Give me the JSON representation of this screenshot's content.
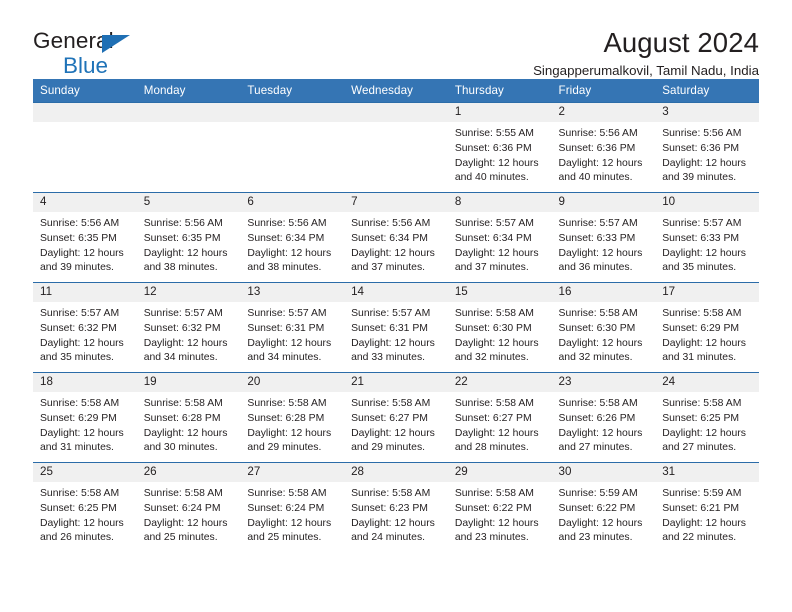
{
  "brand": {
    "line1": "General",
    "line2": "Blue",
    "triangle_color": "#1f6fb4",
    "text_color": "#231f20",
    "accent_color": "#1f73b8"
  },
  "header": {
    "title": "August 2024",
    "subtitle": "Singapperumalkovil, Tamil Nadu, India"
  },
  "calendar": {
    "header_bg": "#3575b4",
    "header_text": "#ffffff",
    "daynum_bg": "#f0f0f0",
    "row_border": "#2b6ca8",
    "weekday_headers": [
      "Sunday",
      "Monday",
      "Tuesday",
      "Wednesday",
      "Thursday",
      "Friday",
      "Saturday"
    ],
    "weeks": [
      [
        {
          "day": "",
          "sunrise": "",
          "sunset": "",
          "daylight_line1": "",
          "daylight_line2": ""
        },
        {
          "day": "",
          "sunrise": "",
          "sunset": "",
          "daylight_line1": "",
          "daylight_line2": ""
        },
        {
          "day": "",
          "sunrise": "",
          "sunset": "",
          "daylight_line1": "",
          "daylight_line2": ""
        },
        {
          "day": "",
          "sunrise": "",
          "sunset": "",
          "daylight_line1": "",
          "daylight_line2": ""
        },
        {
          "day": "1",
          "sunrise": "Sunrise: 5:55 AM",
          "sunset": "Sunset: 6:36 PM",
          "daylight_line1": "Daylight: 12 hours",
          "daylight_line2": "and 40 minutes."
        },
        {
          "day": "2",
          "sunrise": "Sunrise: 5:56 AM",
          "sunset": "Sunset: 6:36 PM",
          "daylight_line1": "Daylight: 12 hours",
          "daylight_line2": "and 40 minutes."
        },
        {
          "day": "3",
          "sunrise": "Sunrise: 5:56 AM",
          "sunset": "Sunset: 6:36 PM",
          "daylight_line1": "Daylight: 12 hours",
          "daylight_line2": "and 39 minutes."
        }
      ],
      [
        {
          "day": "4",
          "sunrise": "Sunrise: 5:56 AM",
          "sunset": "Sunset: 6:35 PM",
          "daylight_line1": "Daylight: 12 hours",
          "daylight_line2": "and 39 minutes."
        },
        {
          "day": "5",
          "sunrise": "Sunrise: 5:56 AM",
          "sunset": "Sunset: 6:35 PM",
          "daylight_line1": "Daylight: 12 hours",
          "daylight_line2": "and 38 minutes."
        },
        {
          "day": "6",
          "sunrise": "Sunrise: 5:56 AM",
          "sunset": "Sunset: 6:34 PM",
          "daylight_line1": "Daylight: 12 hours",
          "daylight_line2": "and 38 minutes."
        },
        {
          "day": "7",
          "sunrise": "Sunrise: 5:56 AM",
          "sunset": "Sunset: 6:34 PM",
          "daylight_line1": "Daylight: 12 hours",
          "daylight_line2": "and 37 minutes."
        },
        {
          "day": "8",
          "sunrise": "Sunrise: 5:57 AM",
          "sunset": "Sunset: 6:34 PM",
          "daylight_line1": "Daylight: 12 hours",
          "daylight_line2": "and 37 minutes."
        },
        {
          "day": "9",
          "sunrise": "Sunrise: 5:57 AM",
          "sunset": "Sunset: 6:33 PM",
          "daylight_line1": "Daylight: 12 hours",
          "daylight_line2": "and 36 minutes."
        },
        {
          "day": "10",
          "sunrise": "Sunrise: 5:57 AM",
          "sunset": "Sunset: 6:33 PM",
          "daylight_line1": "Daylight: 12 hours",
          "daylight_line2": "and 35 minutes."
        }
      ],
      [
        {
          "day": "11",
          "sunrise": "Sunrise: 5:57 AM",
          "sunset": "Sunset: 6:32 PM",
          "daylight_line1": "Daylight: 12 hours",
          "daylight_line2": "and 35 minutes."
        },
        {
          "day": "12",
          "sunrise": "Sunrise: 5:57 AM",
          "sunset": "Sunset: 6:32 PM",
          "daylight_line1": "Daylight: 12 hours",
          "daylight_line2": "and 34 minutes."
        },
        {
          "day": "13",
          "sunrise": "Sunrise: 5:57 AM",
          "sunset": "Sunset: 6:31 PM",
          "daylight_line1": "Daylight: 12 hours",
          "daylight_line2": "and 34 minutes."
        },
        {
          "day": "14",
          "sunrise": "Sunrise: 5:57 AM",
          "sunset": "Sunset: 6:31 PM",
          "daylight_line1": "Daylight: 12 hours",
          "daylight_line2": "and 33 minutes."
        },
        {
          "day": "15",
          "sunrise": "Sunrise: 5:58 AM",
          "sunset": "Sunset: 6:30 PM",
          "daylight_line1": "Daylight: 12 hours",
          "daylight_line2": "and 32 minutes."
        },
        {
          "day": "16",
          "sunrise": "Sunrise: 5:58 AM",
          "sunset": "Sunset: 6:30 PM",
          "daylight_line1": "Daylight: 12 hours",
          "daylight_line2": "and 32 minutes."
        },
        {
          "day": "17",
          "sunrise": "Sunrise: 5:58 AM",
          "sunset": "Sunset: 6:29 PM",
          "daylight_line1": "Daylight: 12 hours",
          "daylight_line2": "and 31 minutes."
        }
      ],
      [
        {
          "day": "18",
          "sunrise": "Sunrise: 5:58 AM",
          "sunset": "Sunset: 6:29 PM",
          "daylight_line1": "Daylight: 12 hours",
          "daylight_line2": "and 31 minutes."
        },
        {
          "day": "19",
          "sunrise": "Sunrise: 5:58 AM",
          "sunset": "Sunset: 6:28 PM",
          "daylight_line1": "Daylight: 12 hours",
          "daylight_line2": "and 30 minutes."
        },
        {
          "day": "20",
          "sunrise": "Sunrise: 5:58 AM",
          "sunset": "Sunset: 6:28 PM",
          "daylight_line1": "Daylight: 12 hours",
          "daylight_line2": "and 29 minutes."
        },
        {
          "day": "21",
          "sunrise": "Sunrise: 5:58 AM",
          "sunset": "Sunset: 6:27 PM",
          "daylight_line1": "Daylight: 12 hours",
          "daylight_line2": "and 29 minutes."
        },
        {
          "day": "22",
          "sunrise": "Sunrise: 5:58 AM",
          "sunset": "Sunset: 6:27 PM",
          "daylight_line1": "Daylight: 12 hours",
          "daylight_line2": "and 28 minutes."
        },
        {
          "day": "23",
          "sunrise": "Sunrise: 5:58 AM",
          "sunset": "Sunset: 6:26 PM",
          "daylight_line1": "Daylight: 12 hours",
          "daylight_line2": "and 27 minutes."
        },
        {
          "day": "24",
          "sunrise": "Sunrise: 5:58 AM",
          "sunset": "Sunset: 6:25 PM",
          "daylight_line1": "Daylight: 12 hours",
          "daylight_line2": "and 27 minutes."
        }
      ],
      [
        {
          "day": "25",
          "sunrise": "Sunrise: 5:58 AM",
          "sunset": "Sunset: 6:25 PM",
          "daylight_line1": "Daylight: 12 hours",
          "daylight_line2": "and 26 minutes."
        },
        {
          "day": "26",
          "sunrise": "Sunrise: 5:58 AM",
          "sunset": "Sunset: 6:24 PM",
          "daylight_line1": "Daylight: 12 hours",
          "daylight_line2": "and 25 minutes."
        },
        {
          "day": "27",
          "sunrise": "Sunrise: 5:58 AM",
          "sunset": "Sunset: 6:24 PM",
          "daylight_line1": "Daylight: 12 hours",
          "daylight_line2": "and 25 minutes."
        },
        {
          "day": "28",
          "sunrise": "Sunrise: 5:58 AM",
          "sunset": "Sunset: 6:23 PM",
          "daylight_line1": "Daylight: 12 hours",
          "daylight_line2": "and 24 minutes."
        },
        {
          "day": "29",
          "sunrise": "Sunrise: 5:58 AM",
          "sunset": "Sunset: 6:22 PM",
          "daylight_line1": "Daylight: 12 hours",
          "daylight_line2": "and 23 minutes."
        },
        {
          "day": "30",
          "sunrise": "Sunrise: 5:59 AM",
          "sunset": "Sunset: 6:22 PM",
          "daylight_line1": "Daylight: 12 hours",
          "daylight_line2": "and 23 minutes."
        },
        {
          "day": "31",
          "sunrise": "Sunrise: 5:59 AM",
          "sunset": "Sunset: 6:21 PM",
          "daylight_line1": "Daylight: 12 hours",
          "daylight_line2": "and 22 minutes."
        }
      ]
    ]
  }
}
